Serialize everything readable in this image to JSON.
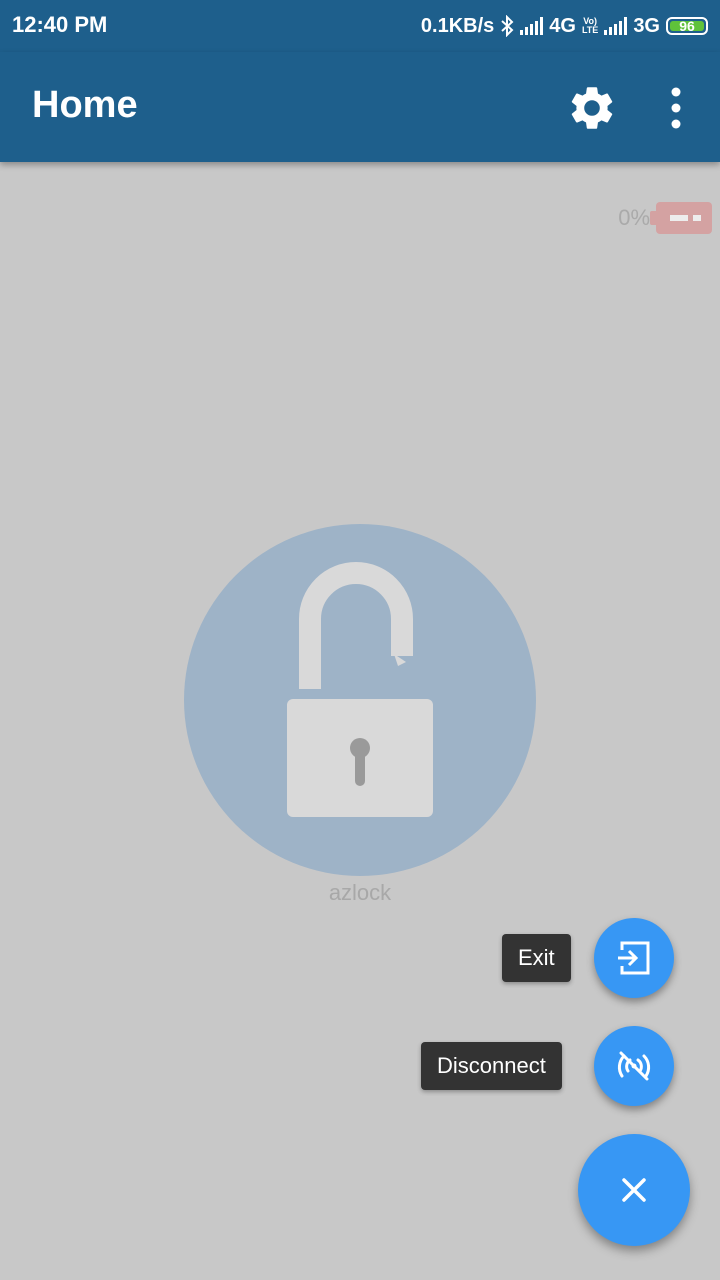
{
  "status_bar": {
    "time": "12:40 PM",
    "speed": "0.1KB/s",
    "network1": "4G",
    "volte_top": "Vo)",
    "volte_bottom": "LTE",
    "network2": "3G",
    "battery": "96"
  },
  "app_bar": {
    "title": "Home",
    "settings_icon": "gear-icon",
    "overflow_icon": "more-vert-icon"
  },
  "device": {
    "battery_percent": "0%",
    "lock_state_icon": "unlocked-padlock-icon",
    "name": "azlock"
  },
  "fab_menu": {
    "exit_label": "Exit",
    "disconnect_label": "Disconnect",
    "close_icon": "close-icon"
  },
  "colors": {
    "primary": "#1e5f8c",
    "accent": "#3797f4",
    "scrim": "#c8c8c8",
    "battery_low": "#d4a2a2"
  }
}
